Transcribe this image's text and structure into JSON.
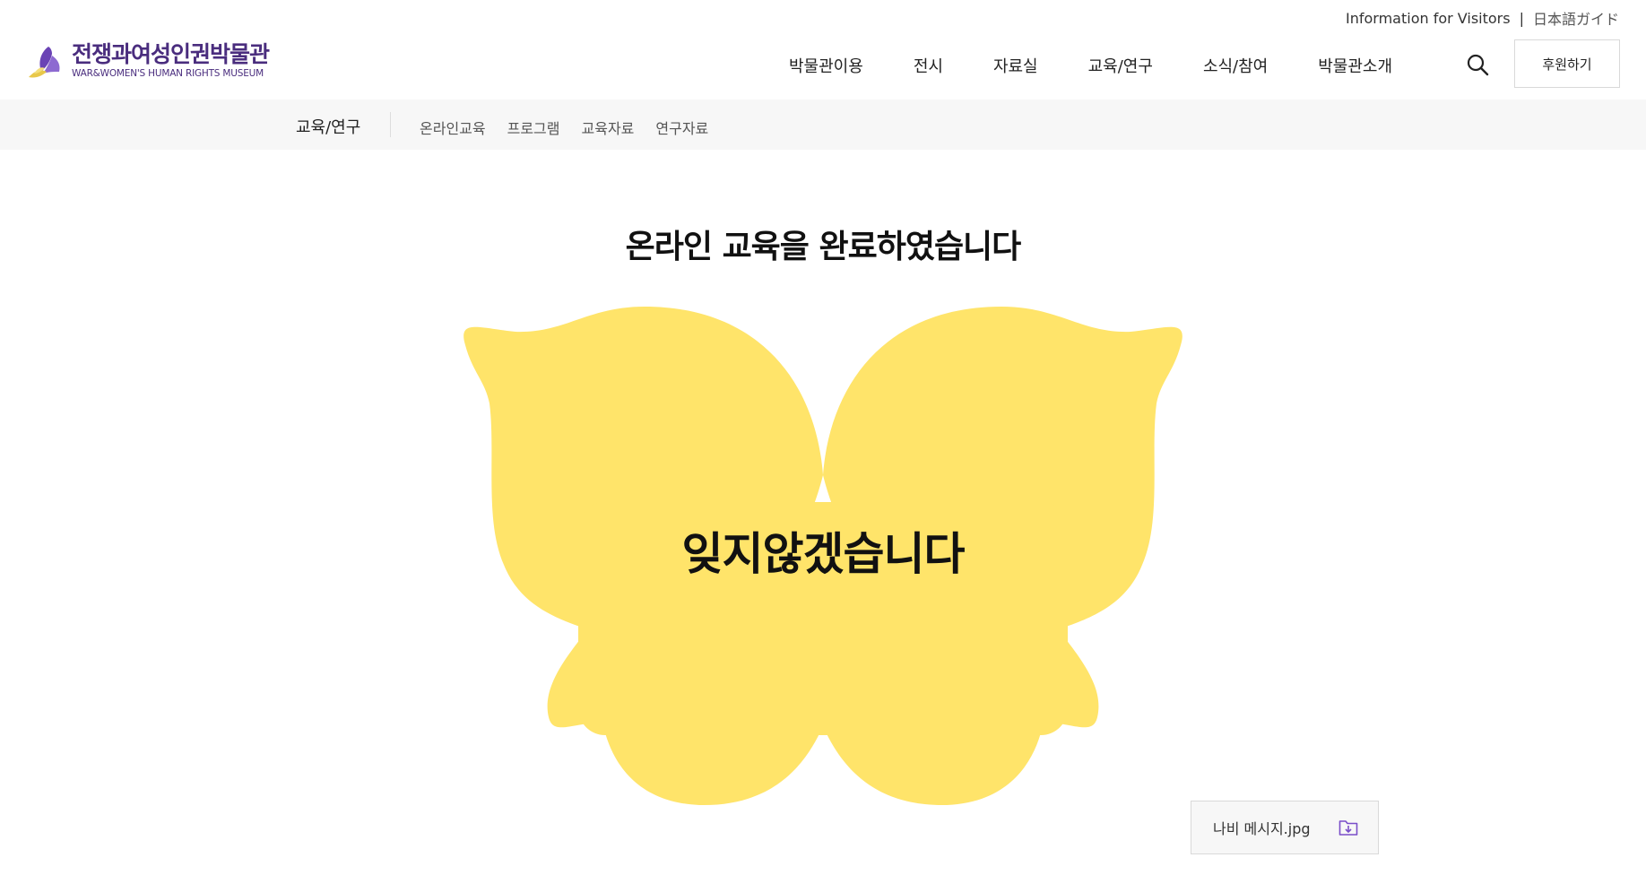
{
  "utility": {
    "visitors_label": "Information for Visitors",
    "separator": "|",
    "japanese_label": "日本語ガイド"
  },
  "logo": {
    "name_ko": "전쟁과여성인권박물관",
    "name_en": "WAR&WOMEN'S HUMAN RIGHTS MUSEUM"
  },
  "gnb": {
    "items": [
      "박물관이용",
      "전시",
      "자료실",
      "교육/연구",
      "소식/참여",
      "박물관소개"
    ]
  },
  "header": {
    "donate_label": "후원하기",
    "search_icon": "search-icon"
  },
  "subnav": {
    "current": "교육/연구",
    "items": [
      "온라인교육",
      "프로그램",
      "교육자료",
      "연구자료"
    ]
  },
  "main": {
    "title": "온라인 교육을 완료하였습니다",
    "butterfly_message": "잊지않겠습니다",
    "butterfly_color": "#ffe46a"
  },
  "download": {
    "filename": "나비 메시지.jpg",
    "icon": "download-folder-icon",
    "icon_color": "#7a4fc9"
  },
  "colors": {
    "brand": "#4a2d7e",
    "subnav_bg": "#f7f7f7"
  }
}
